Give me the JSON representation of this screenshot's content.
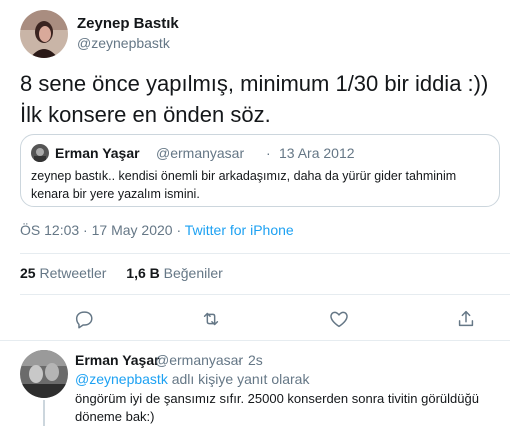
{
  "tweet": {
    "author_name": "Zeynep Bastık",
    "author_handle": "@zeynepbastk",
    "text": "8 sene önce yapılmış, minimum 1/30 bir iddia :)) İlk konsere en önden söz.",
    "time": "ÖS 12:03",
    "date": "17 May 2020",
    "meta_separator": " · ",
    "source": "Twitter for iPhone"
  },
  "quote": {
    "author_name": "Erman Yaşar",
    "author_handle": "@ermanyasar",
    "separator": "·",
    "date": "13 Ara 2012",
    "text": "zeynep bastık.. kendisi önemli bir arkadaşımız, daha da yürür gider tahminim kenara bir yere yazalım ismini."
  },
  "stats": {
    "retweets_count": "25",
    "retweets_label": "Retweetler",
    "likes_count": "1,6 B",
    "likes_label": "Beğeniler"
  },
  "actions": {
    "reply_icon": "reply-icon",
    "retweet_icon": "retweet-icon",
    "like_icon": "heart-icon",
    "share_icon": "share-icon"
  },
  "reply": {
    "author_name": "Erman Yaşar",
    "author_handle": "@ermanyasar",
    "separator": "·",
    "time": "2s",
    "replying_to_handle": "@zeynepbastk",
    "replying_to_suffix": " adlı kişiye yanıt olarak",
    "text": "öngörüm iyi de şansımız sıfır. 25000 konserden sonra tivitin görüldüğü döneme bak:)"
  },
  "colors": {
    "accent": "#1da1f2",
    "secondary_text": "#657786",
    "border": "#ccd6dd",
    "divider": "#e6ecf0"
  }
}
